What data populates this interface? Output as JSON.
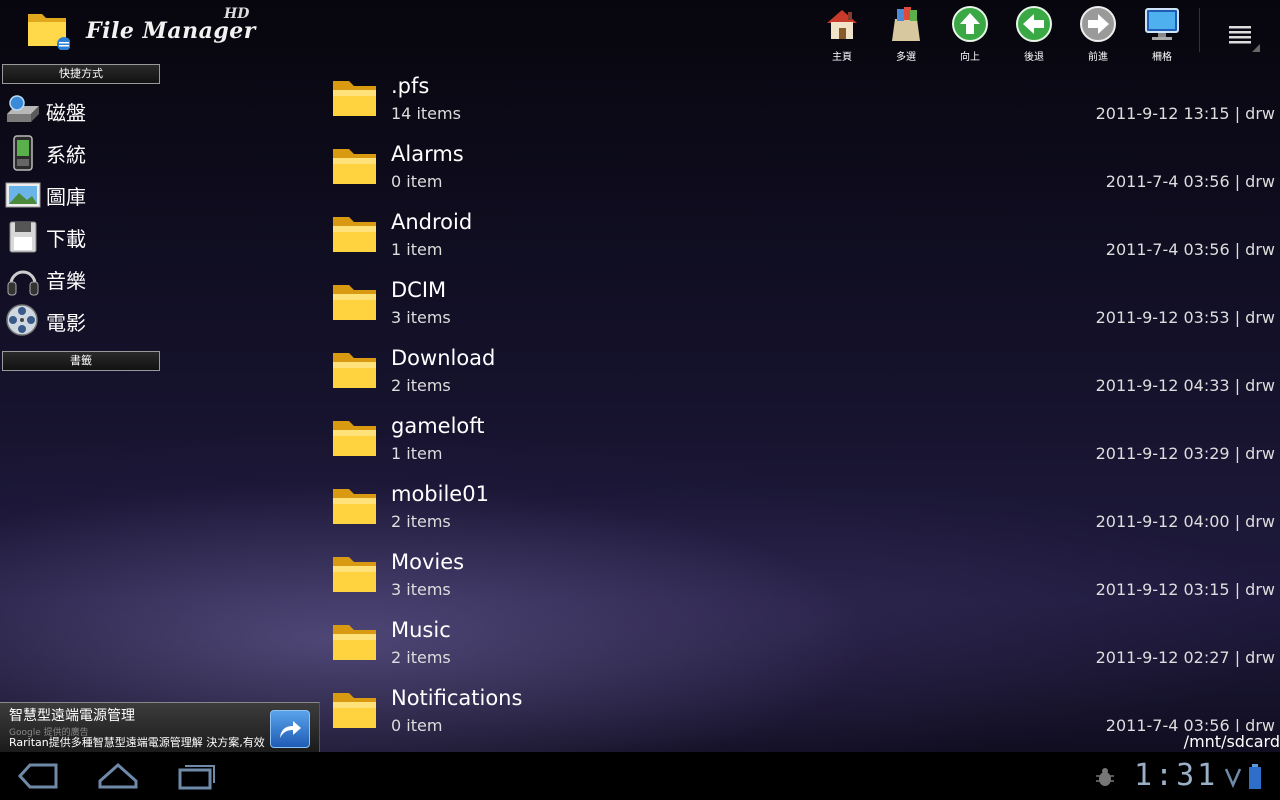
{
  "app": {
    "title": "File Manager",
    "badge": "HD"
  },
  "toolbar": [
    {
      "label": "主頁",
      "icon": "home-icon"
    },
    {
      "label": "多選",
      "icon": "multi-select-icon"
    },
    {
      "label": "向上",
      "icon": "up-arrow-icon"
    },
    {
      "label": "後退",
      "icon": "back-arrow-icon"
    },
    {
      "label": "前進",
      "icon": "forward-arrow-icon"
    },
    {
      "label": "柵格",
      "icon": "grid-monitor-icon"
    }
  ],
  "sidebar": {
    "shortcuts_header": "快捷方式",
    "items": [
      {
        "label": "磁盤",
        "icon": "disk-icon"
      },
      {
        "label": "系統",
        "icon": "phone-icon"
      },
      {
        "label": "圖庫",
        "icon": "gallery-icon"
      },
      {
        "label": "下載",
        "icon": "floppy-icon"
      },
      {
        "label": "音樂",
        "icon": "headphones-icon"
      },
      {
        "label": "電影",
        "icon": "film-reel-icon"
      }
    ],
    "bookmarks_header": "書籤"
  },
  "files": [
    {
      "name": ".pfs",
      "count": "14 items",
      "meta": "2011-9-12 13:15 | drw"
    },
    {
      "name": "Alarms",
      "count": "0 item",
      "meta": "2011-7-4 03:56 | drw"
    },
    {
      "name": "Android",
      "count": "1 item",
      "meta": "2011-7-4 03:56 | drw"
    },
    {
      "name": "DCIM",
      "count": "3 items",
      "meta": "2011-9-12 03:53 | drw"
    },
    {
      "name": "Download",
      "count": "2 items",
      "meta": "2011-9-12 04:33 | drw"
    },
    {
      "name": "gameloft",
      "count": "1 item",
      "meta": "2011-9-12 03:29 | drw"
    },
    {
      "name": "mobile01",
      "count": "2 items",
      "meta": "2011-9-12 04:00 | drw"
    },
    {
      "name": "Movies",
      "count": "3 items",
      "meta": "2011-9-12 03:15 | drw"
    },
    {
      "name": "Music",
      "count": "2 items",
      "meta": "2011-9-12 02:27 | drw"
    },
    {
      "name": "Notifications",
      "count": "0 item",
      "meta": "2011-7-4 03:56 | drw"
    }
  ],
  "path": "/mnt/sdcard",
  "ad": {
    "title": "智慧型遠端電源管理",
    "google": "Google 提供的廣告",
    "body": "Raritan提供多種智慧型遠端電源管理解 決方案,有效"
  },
  "status": {
    "time": "1:31"
  },
  "colors": {
    "folder": "#f4c531",
    "accent": "#9ab0c8"
  }
}
